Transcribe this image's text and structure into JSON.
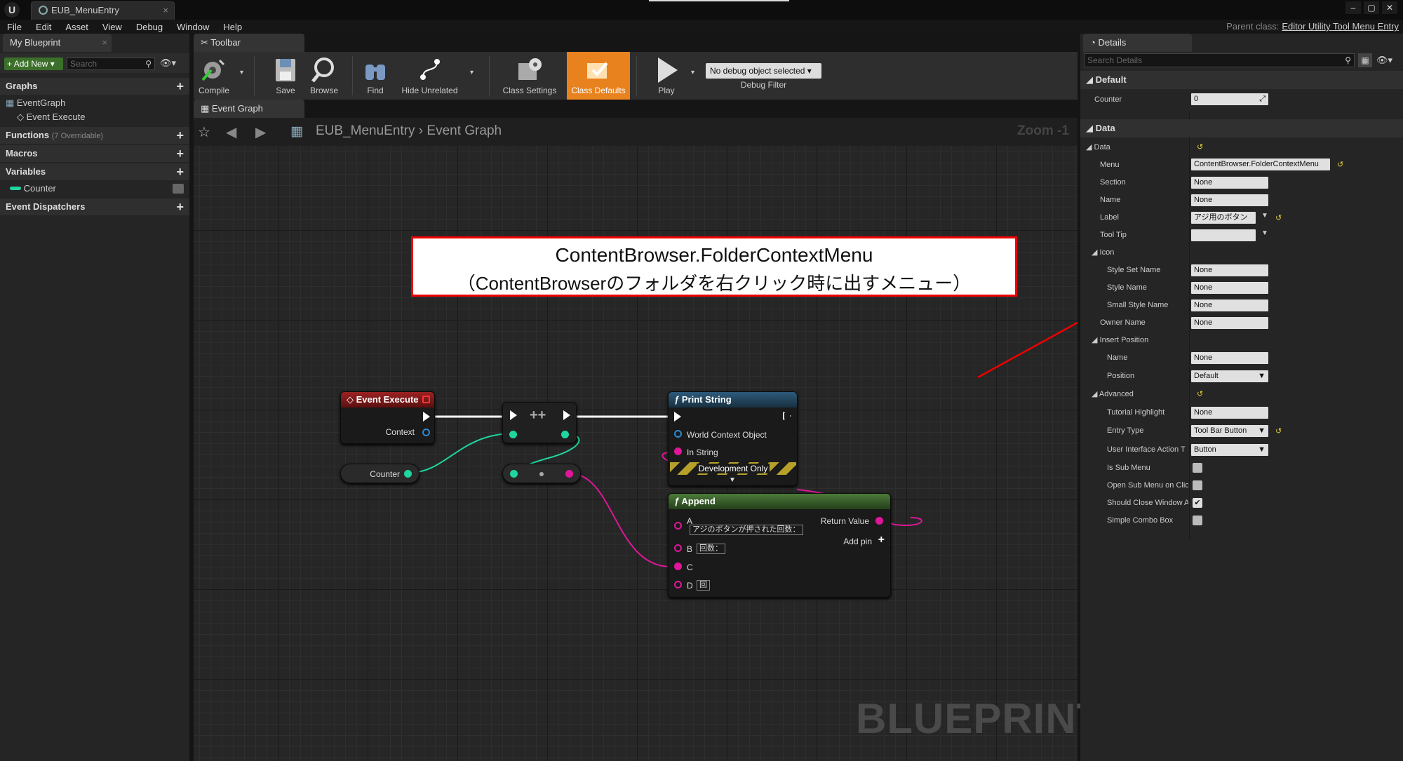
{
  "window": {
    "tab_title": "EUB_MenuEntry",
    "close": "×",
    "parent_class_label": "Parent class:",
    "parent_class": "Editor Utility Tool Menu Entry"
  },
  "menu": [
    "File",
    "Edit",
    "Asset",
    "View",
    "Debug",
    "Window",
    "Help"
  ],
  "left": {
    "tab": "My Blueprint",
    "add_new": "Add New",
    "search_placeholder": "Search",
    "graphs": "Graphs",
    "eventgraph": "EventGraph",
    "event_execute": "Event Execute",
    "functions": "Functions",
    "functions_count": "(7 Overridable)",
    "macros": "Macros",
    "variables": "Variables",
    "var_counter": "Counter",
    "dispatchers": "Event Dispatchers"
  },
  "toolbar": {
    "tab": "Toolbar",
    "compile": "Compile",
    "save": "Save",
    "browse": "Browse",
    "find": "Find",
    "hide": "Hide Unrelated",
    "class_settings": "Class Settings",
    "class_defaults": "Class Defaults",
    "play": "Play",
    "debug_select": "No debug object selected",
    "debug_filter": "Debug Filter"
  },
  "graph": {
    "tab": "Event Graph",
    "crumb_root": "EUB_MenuEntry",
    "crumb_sep": "›",
    "crumb_leaf": "Event Graph",
    "zoom": "Zoom -1",
    "watermark": "BLUEPRINT"
  },
  "annotation": {
    "line1": "ContentBrowser.FolderContextMenu",
    "line2": "（ContentBrowserのフォルダを右クリック時に出すメニュー）"
  },
  "nodes": {
    "event_execute": {
      "title": "Event Execute",
      "context": "Context"
    },
    "counter": "Counter",
    "increment": "++",
    "print_string": {
      "title": "Print String",
      "world": "World Context Object",
      "instring": "In String",
      "dev": "Development Only"
    },
    "append": {
      "title": "Append",
      "a": "A",
      "a_val": "アジのボタンが押された回数：",
      "b": "B",
      "b_val": "回数：",
      "c": "C",
      "d": "D",
      "d_val": "回",
      "ret": "Return Value",
      "addpin": "Add pin"
    }
  },
  "details": {
    "tab": "Details",
    "search_placeholder": "Search Details",
    "cat_default": "Default",
    "counter": "Counter",
    "counter_val": "0",
    "cat_data": "Data",
    "data": "Data",
    "menu": "Menu",
    "menu_val": "ContentBrowser.FolderContextMenu",
    "section": "Section",
    "section_val": "None",
    "name": "Name",
    "name_val": "None",
    "label": "Label",
    "label_val": "アジ用のボタン",
    "tooltip": "Tool Tip",
    "icon": "Icon",
    "style_set": "Style Set Name",
    "style_set_val": "None",
    "style_name": "Style Name",
    "style_name_val": "None",
    "small_style": "Small Style Name",
    "small_style_val": "None",
    "owner": "Owner Name",
    "owner_val": "None",
    "insert": "Insert Position",
    "ins_name": "Name",
    "ins_name_val": "None",
    "position": "Position",
    "position_val": "Default",
    "advanced": "Advanced",
    "tutorial": "Tutorial Highlight",
    "tutorial_val": "None",
    "entry": "Entry Type",
    "entry_val": "Tool Bar Button",
    "uiaction": "User Interface Action T",
    "uiaction_val": "Button",
    "submenu": "Is Sub Menu",
    "opensub": "Open Sub Menu on Clic",
    "shouldclose": "Should Close Window A",
    "combo": "Simple Combo Box"
  },
  "colors": {
    "exec": "#ffffff",
    "object": "#2a8ad6",
    "string": "#e0169a",
    "int": "#1fd6a0",
    "annot_border": "#e00000",
    "class_defaults": "#e8821e"
  }
}
